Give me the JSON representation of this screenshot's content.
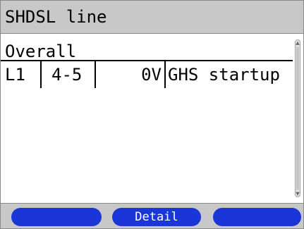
{
  "window": {
    "title": "SHDSL line"
  },
  "main": {
    "section_header": "Overall",
    "rows": [
      {
        "line": "L1",
        "pair": "4-5",
        "voltage": "0V",
        "status": "GHS startup"
      }
    ]
  },
  "softkeys": {
    "left_label": "",
    "center_label": "Detail",
    "right_label": ""
  },
  "colors": {
    "titlebar": "#c8c8c8",
    "softkey": "#1a36d8",
    "softkey_text": "#ffffff"
  },
  "icons": {
    "scroll_up": "scroll-up-arrow",
    "scroll_down": "scroll-down-arrow"
  }
}
